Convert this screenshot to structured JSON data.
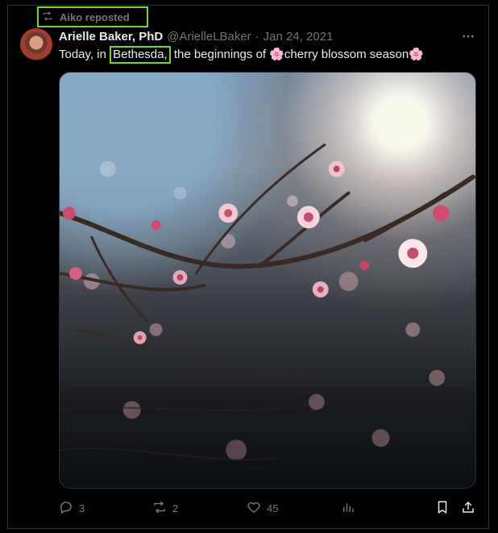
{
  "repost": {
    "label": "Aiko reposted",
    "icon": "repost-icon"
  },
  "tweet": {
    "author_name": "Arielle Baker, PhD",
    "handle": "@ArielleLBaker",
    "separator": "·",
    "date": "Jan 24, 2021",
    "text_before": "Today, in ",
    "text_highlight": "Bethesda,",
    "text_after": " the beginnings of 🌸cherry blossom season🌸",
    "media_alt": "cherry blossom branch photo"
  },
  "actions": {
    "reply_count": "3",
    "repost_count": "2",
    "like_count": "45"
  },
  "colors": {
    "background": "#000000",
    "text": "#e7e9ea",
    "muted": "#71767b",
    "highlight_box": "#7cd32c"
  }
}
